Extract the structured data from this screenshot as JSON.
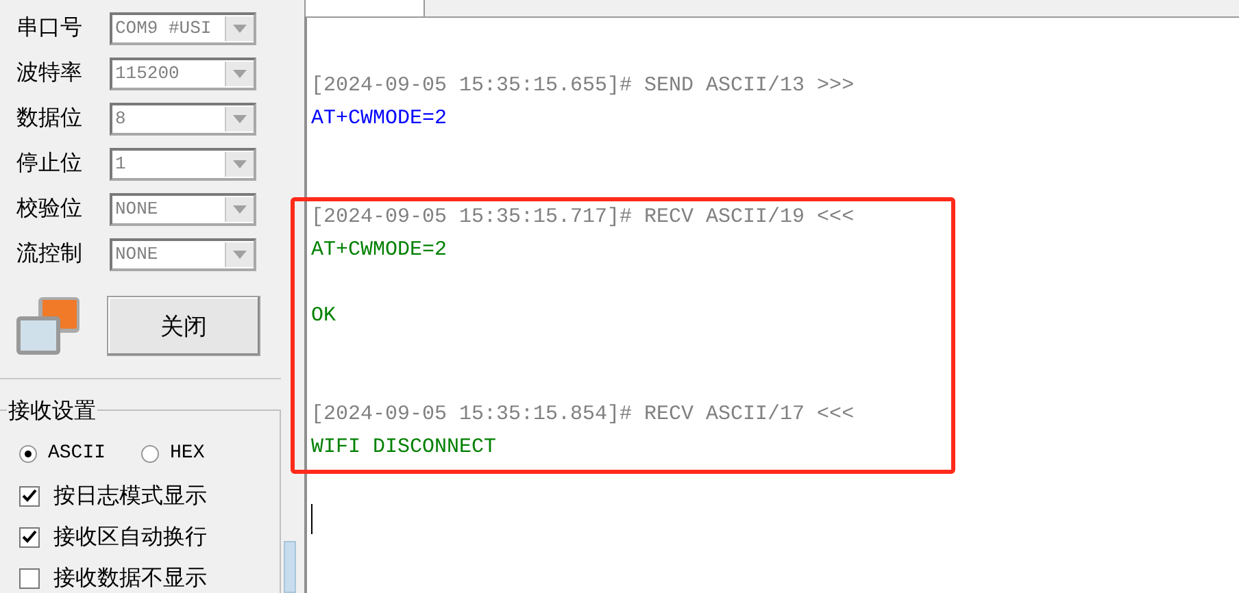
{
  "serial_settings": {
    "fields": [
      {
        "label": "串口号",
        "value": "COM9 #USI",
        "disabled": true
      },
      {
        "label": "波特率",
        "value": "115200",
        "disabled": true
      },
      {
        "label": "数据位",
        "value": "8",
        "disabled": true
      },
      {
        "label": "停止位",
        "value": "1",
        "disabled": true
      },
      {
        "label": "校验位",
        "value": "NONE",
        "disabled": true
      },
      {
        "label": "流控制",
        "value": "NONE",
        "disabled": true
      }
    ],
    "open_button": "关闭"
  },
  "receive_settings": {
    "title": "接收设置",
    "formats": [
      {
        "label": "ASCII",
        "selected": true
      },
      {
        "label": "HEX",
        "selected": false
      }
    ],
    "options": [
      {
        "label": "按日志模式显示",
        "checked": true
      },
      {
        "label": "接收区自动换行",
        "checked": true
      },
      {
        "label": "接收数据不显示",
        "checked": false
      }
    ]
  },
  "log": [
    {
      "kind": "send",
      "highlighted": false,
      "header": "[2024-09-05 15:35:15.655]# SEND ASCII/13 >>>",
      "body": [
        "AT+CWMODE=2"
      ]
    },
    {
      "kind": "recv",
      "highlighted": true,
      "header": "[2024-09-05 15:35:15.717]# RECV ASCII/19 <<<",
      "body": [
        "AT+CWMODE=2",
        "OK"
      ]
    },
    {
      "kind": "recv",
      "highlighted": true,
      "header": "[2024-09-05 15:35:15.854]# RECV ASCII/17 <<<",
      "body": [
        "WIFI DISCONNECT"
      ]
    }
  ]
}
